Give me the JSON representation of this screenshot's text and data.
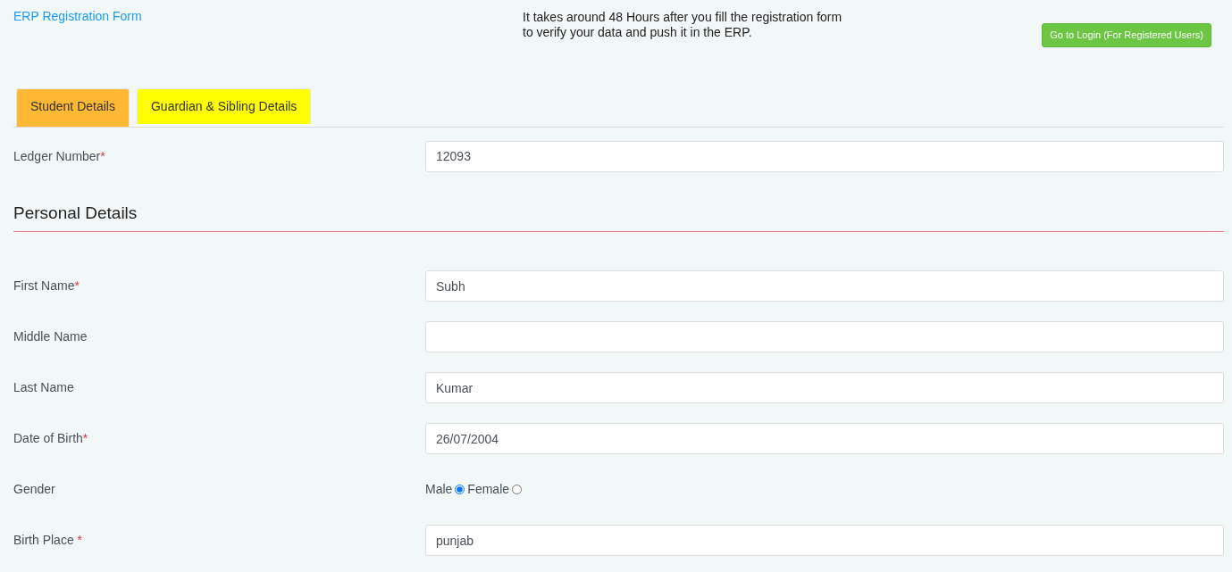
{
  "header": {
    "title": "ERP Registration Form",
    "notice_lines": [
      "It takes around 48 Hours after you fill the registration form",
      "to verify your data and push it in the ERP."
    ],
    "login_button": "Go to Login (For Registered Users)"
  },
  "tabs": [
    {
      "label": "Student Details",
      "selected": true,
      "color": "#ffb833"
    },
    {
      "label": "Guardian & Sibling Details",
      "selected": false,
      "color": "#ffff00"
    }
  ],
  "ledger": {
    "label": "Ledger Number",
    "required_mark": "*",
    "value": "12093"
  },
  "section": {
    "title": "Personal Details"
  },
  "fields": [
    {
      "kind": "text",
      "label": "First Name",
      "required_mark": "*",
      "value": "Subh"
    },
    {
      "kind": "text",
      "label": "Middle Name"
    },
    {
      "kind": "text",
      "label": "Last Name",
      "value": "Kumar"
    },
    {
      "kind": "text",
      "label": "Date of Birth",
      "required_mark": "*",
      "value": "26/07/2004"
    },
    {
      "kind": "radio",
      "label": "Gender",
      "options": [
        {
          "label": "Male",
          "selected": true
        },
        {
          "label": "Female",
          "selected": false
        }
      ]
    },
    {
      "kind": "text",
      "label": "Birth Place",
      "required_mark": " *",
      "value": "punjab"
    }
  ]
}
